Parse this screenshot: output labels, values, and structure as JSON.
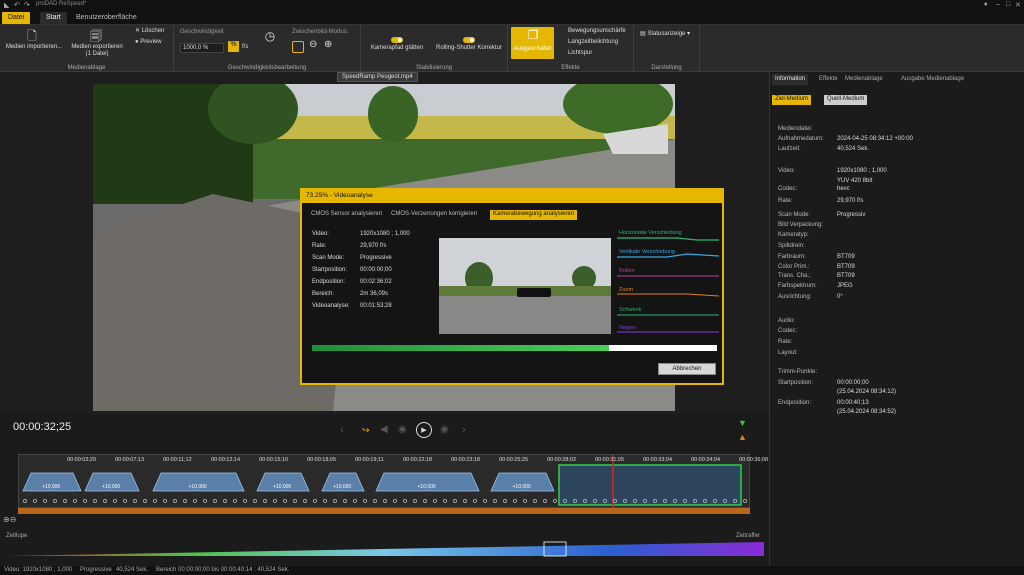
{
  "title": "proDAD ReSpeed*",
  "tabs": {
    "file": "Datei",
    "start": "Start",
    "ui": "Benutzeroberfläche"
  },
  "ribbon": {
    "import": "Medien importieren...",
    "export": "Medien exportieren",
    "export_sub": "(1 Datei)",
    "delete": "Löschen",
    "preview": "Preview",
    "group_media": "Medienablage",
    "speed_label": "Geschwindigkeit",
    "speed_value": "1000,0 %",
    "speed_unit": "f/s",
    "frame_mode": "Zwischenbild-Modus:",
    "group_speed": "Geschwindigkeitsbearbeitung",
    "cam_smooth": "Kamerapfad glätten",
    "rolling": "Rolling-Shutter Korrektur",
    "group_stab": "Stabilisierung",
    "disabled": "Ausgeschaltet",
    "motion_blur": "Bewegungsunschärfe",
    "long_exp": "Langzeitbelichtung",
    "light_trail": "Lichtspur",
    "group_effects": "Effekte",
    "status_disp": "Statusanzeige",
    "group_display": "Darstellung"
  },
  "file_label": "SpeedRamp Peugeot.mp4",
  "dialog": {
    "title": "73.25% - Videoanalyse",
    "tabs": [
      "CMOS Sensor analysieren",
      "CMOS-Verzerrungen korrigieren",
      "Kamerabewegung analysieren"
    ],
    "rows": [
      {
        "k": "Video:",
        "v": "1920x1080 ; 1,000"
      },
      {
        "k": "Rate:",
        "v": "29,970 f/s"
      },
      {
        "k": "Scan Mode:",
        "v": "Progressive"
      },
      {
        "k": "Startposition:",
        "v": "00:00:00;00"
      },
      {
        "k": "Endposition:",
        "v": "00:02:36;02"
      },
      {
        "k": "Bereich:",
        "v": "2m 36,09s"
      },
      {
        "k": "Videoanalyse:",
        "v": "00:01:53;28"
      }
    ],
    "curves": [
      "Horizontale Verschiebung",
      "Vertikale Verschiebung",
      "Rollen",
      "Zoom",
      "Schwenk",
      "Neigen"
    ],
    "progress": 0.7325,
    "cancel": "Abbrechen"
  },
  "panel": {
    "tabs": [
      "Information",
      "Effekte",
      "Medienablage",
      "Ausgabe Medienablage"
    ],
    "target": "Ziel-Medium",
    "source": "Quell-Medium",
    "rows": [
      {
        "k": "Mediendatei:",
        "v": ""
      },
      {
        "k": "Aufnahmedatum:",
        "v": "2024-04-25 08:34:12 +00:00"
      },
      {
        "k": "Laufzeit:",
        "v": "40,524 Sek."
      },
      {
        "k": "Video:",
        "v": "1920x1080 ; 1,000"
      },
      {
        "k": "",
        "v": "YUV 420 8bit"
      },
      {
        "k": "Codec:",
        "v": "hevc"
      },
      {
        "k": "Rate:",
        "v": "29,970 f/s"
      },
      {
        "k": "Scan Mode:",
        "v": "Progressiv"
      },
      {
        "k": "Bild Verpackung:",
        "v": ""
      },
      {
        "k": "Kameratyp:",
        "v": ""
      },
      {
        "k": "Spiltdrein:",
        "v": ""
      },
      {
        "k": "Farbraum:",
        "v": "BT709"
      },
      {
        "k": "Color Prim.:",
        "v": "BT709"
      },
      {
        "k": "Trans. Cha.:",
        "v": "BT709"
      },
      {
        "k": "Farbspektrum:",
        "v": "JPEG"
      },
      {
        "k": "Ausrichtung:",
        "v": "0°"
      },
      {
        "k": "Audio:",
        "v": ""
      },
      {
        "k": "Codec:",
        "v": ""
      },
      {
        "k": "Rate:",
        "v": ""
      },
      {
        "k": "Layout:",
        "v": ""
      },
      {
        "k": "Trimm-Punkte:",
        "v": ""
      },
      {
        "k": "Startposition:",
        "v": "00:00:00;00"
      },
      {
        "k": "",
        "v": "(25.04.2024 08:34:12)"
      },
      {
        "k": "Endposition:",
        "v": "00:00:40;13"
      },
      {
        "k": "",
        "v": "(25.04.2024 08:34:52)"
      }
    ]
  },
  "timeline": {
    "timecode": "00:00:32;25",
    "ruler": [
      "00:00:03;20",
      "00:00:07;13",
      "00:00:11;12",
      "00:00:12;14",
      "00:00:15;10",
      "00:00:18;05",
      "00:00:19;11",
      "00:00:22;18",
      "00:00:23;18",
      "00:00:25;25",
      "00:00:28;02",
      "00:00:31;05",
      "00:00:33;04",
      "00:00:34;04",
      "00:00:36;08"
    ],
    "seg_label": "+10,000",
    "slow": "Zeitlupe",
    "fast": "Zeitraffer"
  },
  "status": {
    "video": "Video: 1920x1080 ; 1,000",
    "scan": "Progressive",
    "dur": "40,524 Sek.",
    "range": "Bereich 00:00:00;00 bis 00:00:40;14 : 40,524 Sek."
  }
}
